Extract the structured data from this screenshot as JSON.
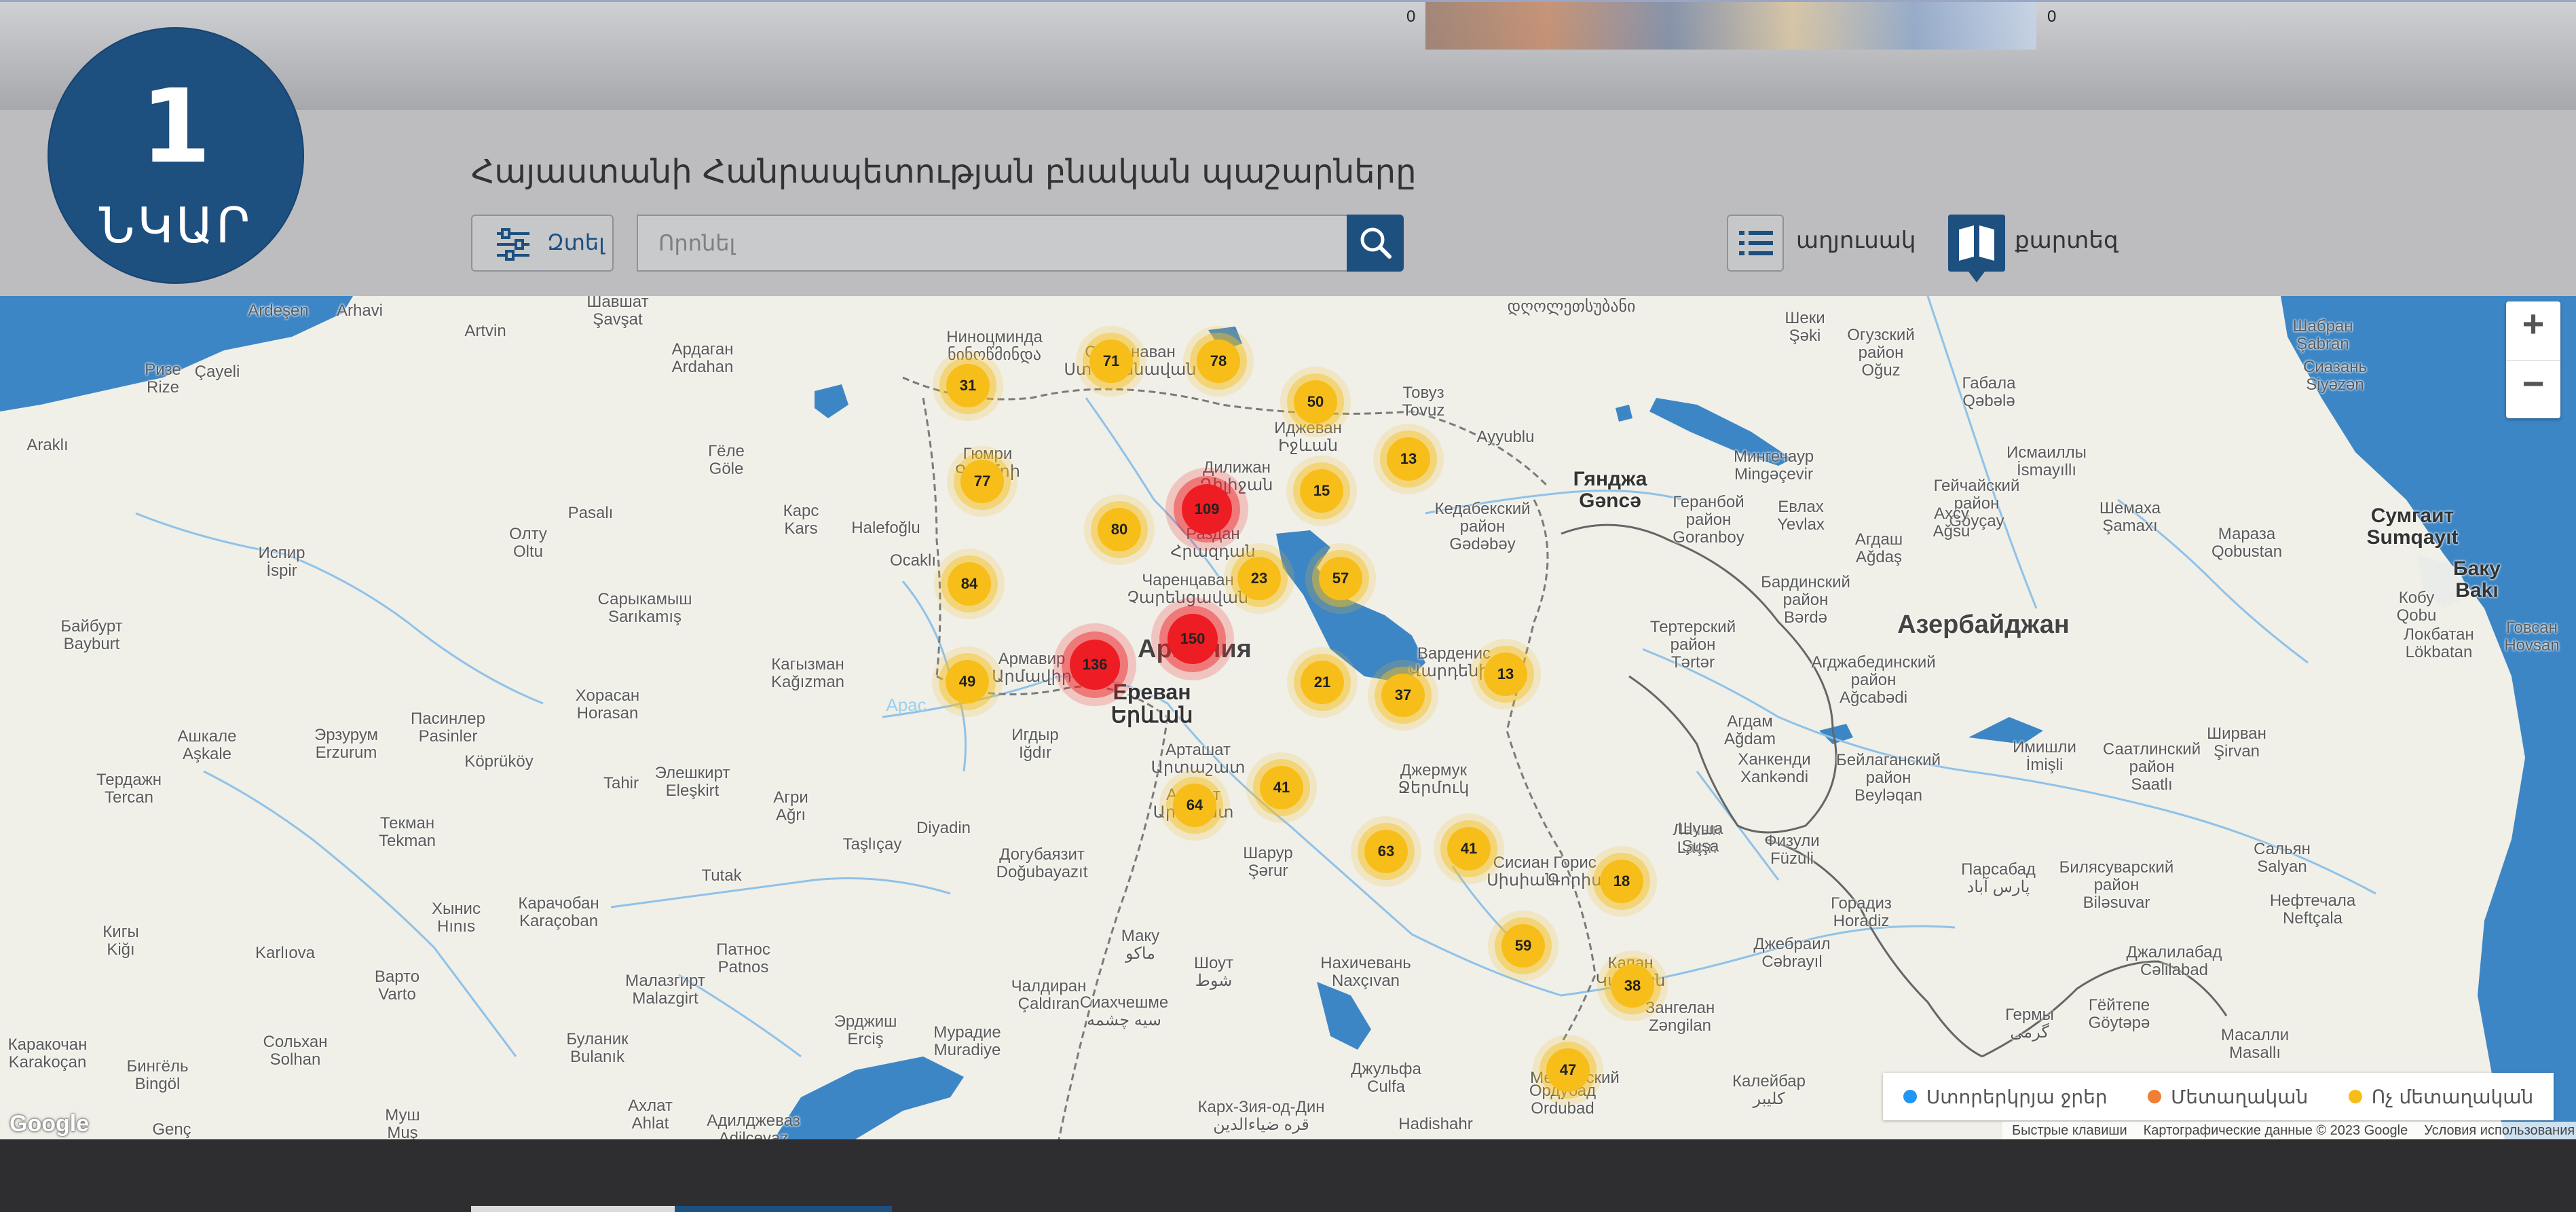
{
  "banner": {
    "tick_left": "0",
    "tick_right": "0"
  },
  "badge": {
    "number": "1",
    "word": "ՆԿԱՐ"
  },
  "header": {
    "title": "Հայաստանի Հանրապետության բնական պաշարները",
    "filter_label": "Զտել",
    "search_placeholder": "Որոնել",
    "view_list_label": "աղյուսակ",
    "view_map_label": "քարտեզ"
  },
  "colors": {
    "brand": "#1d4f7f",
    "cluster_yellow": "#f7be1a",
    "cluster_red": "#ee1c23",
    "water": "#3d86c6",
    "legend_underground": "#2196f3",
    "legend_metal": "#f07f33",
    "legend_nonmetal": "#f7be1a"
  },
  "map": {
    "places": [
      {
        "name": "Шавшат\nŞavşat"
      },
      {
        "name": "Ardeşen"
      },
      {
        "name": "Arhavi"
      },
      {
        "name": "Artvin"
      },
      {
        "name": "Ризе\nRize"
      },
      {
        "name": "Çayeli"
      },
      {
        "name": "Ардаган\nArdahan"
      },
      {
        "name": "Araklı"
      },
      {
        "name": "Гёле\nGöle"
      },
      {
        "name": "Pasalı"
      },
      {
        "name": "Карс\nKars"
      },
      {
        "name": "Halefoğlu"
      },
      {
        "name": "Олту\nOltu"
      },
      {
        "name": "Испир\nİspir"
      },
      {
        "name": "Сарыкамыш\nSarıkamış"
      },
      {
        "name": "Ocaklı"
      },
      {
        "name": "Байбурт\nBayburt"
      },
      {
        "name": "Кагызман\nKağızman"
      },
      {
        "name": "Хорасан\nHorasan"
      },
      {
        "name": "Пасинлер\nPasinler"
      },
      {
        "name": "Эрзурум\nErzurum"
      },
      {
        "name": "Ашкале\nAşkale"
      },
      {
        "name": "Köprüköy"
      },
      {
        "name": "Тердажн\nTercan"
      },
      {
        "name": "Элешкирт\nEleşkirt"
      },
      {
        "name": "Tahir"
      },
      {
        "name": "Агри\nAğrı"
      },
      {
        "name": "Текман\nTekman"
      },
      {
        "name": "Taşlıçay"
      },
      {
        "name": "Diyadin"
      },
      {
        "name": "Догубаязит\nDoğubayazıt"
      },
      {
        "name": "Карачобан\nKaraçoban"
      },
      {
        "name": "Хынис\nHınıs"
      },
      {
        "name": "Tutak"
      },
      {
        "name": "Кигы\nKiğı"
      },
      {
        "name": "Karlıova"
      },
      {
        "name": "Варто\nVarto"
      },
      {
        "name": "Патнос\nPatnos"
      },
      {
        "name": "Малазгирт\nMalazgirt"
      },
      {
        "name": "Булaник\nBulanık"
      },
      {
        "name": "Эрджиш\nErciş"
      },
      {
        "name": "Мурадие\nMuradiye"
      },
      {
        "name": "Чалдиран\nÇaldıran"
      },
      {
        "name": "Каракочан\nKarakoçan"
      },
      {
        "name": "Сольхан\nSolhan"
      },
      {
        "name": "Бингёль\nBingöl"
      },
      {
        "name": "Genç"
      },
      {
        "name": "Муш\nMuş"
      },
      {
        "name": "Ахлат\nAhlat"
      },
      {
        "name": "Адилджеваз\nAdilcevaz"
      },
      {
        "name": "Ниноцминда\nნინოწმინდა"
      },
      {
        "name": "Степанаван\nՍտեփանավան"
      },
      {
        "name": "Гюмри\nԳյումրի"
      },
      {
        "name": "Дилижан\nԴիլիջան"
      },
      {
        "name": "Иджеван\nԻջևան"
      },
      {
        "name": "Товуз\nTovuz"
      },
      {
        "name": "Раздан\nՀրազդան"
      },
      {
        "name": "Чаренцаван\nՉարենցավան"
      },
      {
        "name": "Армавир\nԱրմավիր"
      },
      {
        "name": "Ереван\nԵրևան"
      },
      {
        "name": "Игдыр\nIğdır"
      },
      {
        "name": "Арташат\nԱրտաշատ"
      },
      {
        "name": "Арарат\nԱրարատ"
      },
      {
        "name": "Варденис\nՎարդենիս"
      },
      {
        "name": "Джермук\nՋերմուկ"
      },
      {
        "name": "Шарур\nŞərur"
      },
      {
        "name": "Сисиан\nՍիսիան"
      },
      {
        "name": "Маку\nماکو"
      },
      {
        "name": "Шоут\nشوط"
      },
      {
        "name": "Сиахчешме\nسیه چشمه"
      },
      {
        "name": "Нахичевань\nNaxçıvan"
      },
      {
        "name": "Джульфа\nCulfa"
      },
      {
        "name": "Горис\nԳորիս"
      },
      {
        "name": "Лачын\nLaçın"
      },
      {
        "name": "Капан\nԿապան"
      },
      {
        "name": "Зангелан\nZəngilan"
      },
      {
        "name": "Ордубад\nOrdubad"
      },
      {
        "name": "Карх-Зия-од-Дин\nقره ضیاءالدین"
      },
      {
        "name": "Hadishahr"
      },
      {
        "name": "Мегринский"
      },
      {
        "name": "Калейбар\nکلیبر"
      },
      {
        "name": "Ayyublu"
      },
      {
        "name": "Гянджа\nGəncə"
      },
      {
        "name": "Кедабекский\nрайон\nGədəbəy"
      },
      {
        "name": "Геранбой\nрайон\nGoranboy"
      },
      {
        "name": "Евлах\nYevlax"
      },
      {
        "name": "Тертерский\nрайон\nTərtər"
      },
      {
        "name": "Бардинский\nрайон\nBərdə"
      },
      {
        "name": "Агдам\nAğdam"
      },
      {
        "name": "Агджабединский\nрайон\nAğcabədi"
      },
      {
        "name": "Ханкенди\nXankəndi"
      },
      {
        "name": "Шуша\nŞuşa"
      },
      {
        "name": "Физули\nFüzuli"
      },
      {
        "name": "Горадиз\nHoradiz"
      },
      {
        "name": "Джебраил\nCəbrayıl"
      },
      {
        "name": "Парсабад\nپارس آباد"
      },
      {
        "name": "Бейлаганский\nрайон\nBeyləqan"
      },
      {
        "name": "Имишли\nİmişli"
      },
      {
        "name": "Билясуварский\nрайон\nBiləsuvar"
      },
      {
        "name": "Саатлинский\nрайон\nSaatlı"
      },
      {
        "name": "Ширван\nŞirvan"
      },
      {
        "name": "Сальян\nSalyan"
      },
      {
        "name": "Нефтечала\nNeftçala"
      },
      {
        "name": "Джалилабад\nCəlilabad"
      },
      {
        "name": "Гёйтепе\nGöytəpə"
      },
      {
        "name": "Гермы\nگرمی"
      },
      {
        "name": "Масалли\nMasallı"
      },
      {
        "name": "Азербайджан"
      },
      {
        "name": "Армения"
      },
      {
        "name": "Шеки\nŞəki"
      },
      {
        "name": "Огузский\nрайон\nOğuz"
      },
      {
        "name": "Габала\nQəbələ"
      },
      {
        "name": "Шабран\nŞabran"
      },
      {
        "name": "Сиазань\nSiyəzən"
      },
      {
        "name": "Исмаиллы\nİsmayıllı"
      },
      {
        "name": "Гейчайский\nрайон\nGöyçay"
      },
      {
        "name": "Мингечаур\nMingəçevir"
      },
      {
        "name": "Агдаш\nAğdaş"
      },
      {
        "name": "Ахсу\nAğsu"
      },
      {
        "name": "Шемаха\nŞamaxı"
      },
      {
        "name": "Мараза\nQobustan"
      },
      {
        "name": "Сумгаит\nSumqayıt"
      },
      {
        "name": "Баку\nBakı"
      },
      {
        "name": "Кобу\nQobu"
      },
      {
        "name": "Локбатан\nLökbatan"
      },
      {
        "name": "Говсан\nHovsan"
      },
      {
        "name": "Арас"
      },
      {
        "name": "დღოლეთსუბანი"
      }
    ],
    "clusters": [
      {
        "value": "31",
        "severity": "normal"
      },
      {
        "value": "71",
        "severity": "normal"
      },
      {
        "value": "78",
        "severity": "normal"
      },
      {
        "value": "50",
        "severity": "normal"
      },
      {
        "value": "13",
        "severity": "normal"
      },
      {
        "value": "77",
        "severity": "normal"
      },
      {
        "value": "109",
        "severity": "high"
      },
      {
        "value": "15",
        "severity": "normal"
      },
      {
        "value": "80",
        "severity": "normal"
      },
      {
        "value": "84",
        "severity": "normal"
      },
      {
        "value": "23",
        "severity": "normal"
      },
      {
        "value": "57",
        "severity": "normal"
      },
      {
        "value": "150",
        "severity": "high"
      },
      {
        "value": "136",
        "severity": "high"
      },
      {
        "value": "49",
        "severity": "normal"
      },
      {
        "value": "21",
        "severity": "normal"
      },
      {
        "value": "37",
        "severity": "normal"
      },
      {
        "value": "13",
        "severity": "normal"
      },
      {
        "value": "41",
        "severity": "normal"
      },
      {
        "value": "64",
        "severity": "normal"
      },
      {
        "value": "63",
        "severity": "normal"
      },
      {
        "value": "41",
        "severity": "normal"
      },
      {
        "value": "18",
        "severity": "normal"
      },
      {
        "value": "59",
        "severity": "normal"
      },
      {
        "value": "38",
        "severity": "normal"
      },
      {
        "value": "47",
        "severity": "normal"
      }
    ],
    "zoom_in": "+",
    "zoom_out": "−",
    "google_logo": "Google",
    "legend": [
      {
        "label": "Ստորերկրյա ջրեր",
        "color": "#2196f3"
      },
      {
        "label": "Մետաղական",
        "color": "#f07f33"
      },
      {
        "label": "Ոչ մետաղական",
        "color": "#f7be1a"
      }
    ],
    "attribution": {
      "shortcuts": "Быстрые клавиши",
      "data": "Картографические данные © 2023 Google",
      "terms": "Условия использования"
    }
  }
}
